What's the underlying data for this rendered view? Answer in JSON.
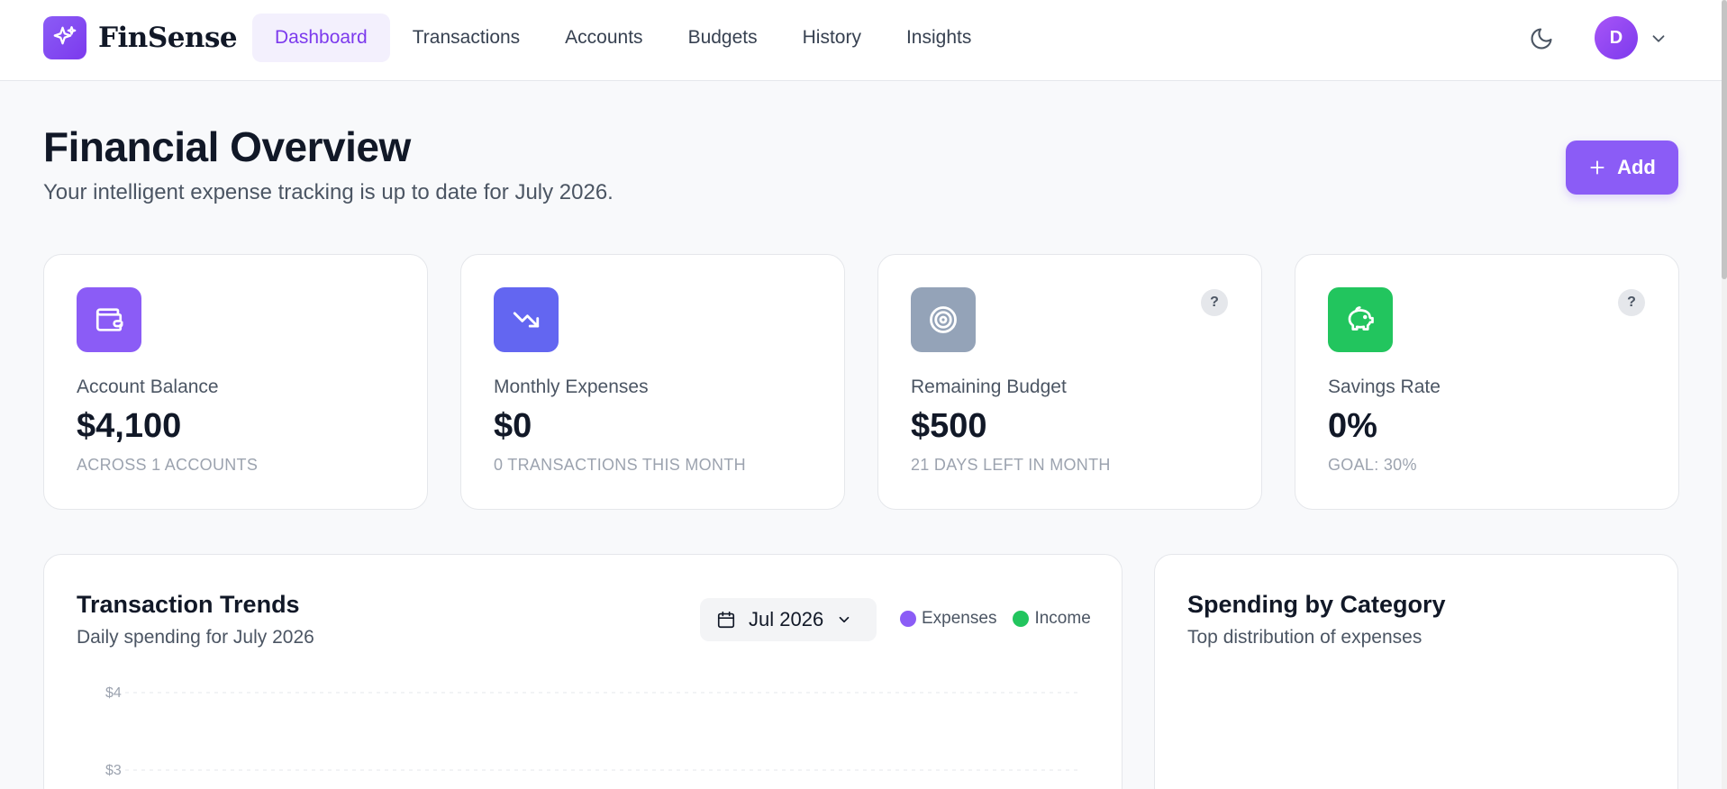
{
  "app": {
    "name": "FinSense"
  },
  "nav": {
    "items": [
      {
        "label": "Dashboard",
        "active": true
      },
      {
        "label": "Transactions"
      },
      {
        "label": "Accounts"
      },
      {
        "label": "Budgets"
      },
      {
        "label": "History"
      },
      {
        "label": "Insights"
      }
    ]
  },
  "user": {
    "initial": "D"
  },
  "header": {
    "title": "Financial Overview",
    "subtitle": "Your intelligent expense tracking is up to date for July 2026.",
    "add_label": "Add"
  },
  "stats": [
    {
      "label": "Account Balance",
      "value": "$4,100",
      "sub": "ACROSS 1 ACCOUNTS",
      "icon": "wallet-icon",
      "color": "#8b5cf6"
    },
    {
      "label": "Monthly Expenses",
      "value": "$0",
      "sub": "0 TRANSACTIONS THIS MONTH",
      "icon": "trending-down-icon",
      "color": "#6366f1"
    },
    {
      "label": "Remaining Budget",
      "value": "$500",
      "sub": "21 DAYS LEFT IN MONTH",
      "icon": "target-icon",
      "color": "#94a3b8",
      "help": "?"
    },
    {
      "label": "Savings Rate",
      "value": "0%",
      "sub": "GOAL: 30%",
      "icon": "piggy-bank-icon",
      "color": "#22c55e",
      "help": "?"
    }
  ],
  "trends": {
    "title": "Transaction Trends",
    "subtitle": "Daily spending for July 2026",
    "month": "Jul 2026",
    "legend": [
      {
        "name": "Expenses",
        "color": "#8b5cf6"
      },
      {
        "name": "Income",
        "color": "#22c55e"
      }
    ]
  },
  "chart_data": {
    "type": "line",
    "title": "Transaction Trends",
    "subtitle": "Daily spending for July 2026",
    "xlabel": "",
    "ylabel": "",
    "y_ticks": [
      "$4",
      "$3"
    ],
    "ylim": [
      0,
      4
    ],
    "grid": true,
    "legend_position": "top-right",
    "series": [
      {
        "name": "Expenses",
        "values": []
      },
      {
        "name": "Income",
        "values": []
      }
    ]
  },
  "category": {
    "title": "Spending by Category",
    "subtitle": "Top distribution of expenses"
  },
  "colors": {
    "accent": "#8b5cf6",
    "income": "#22c55e"
  }
}
